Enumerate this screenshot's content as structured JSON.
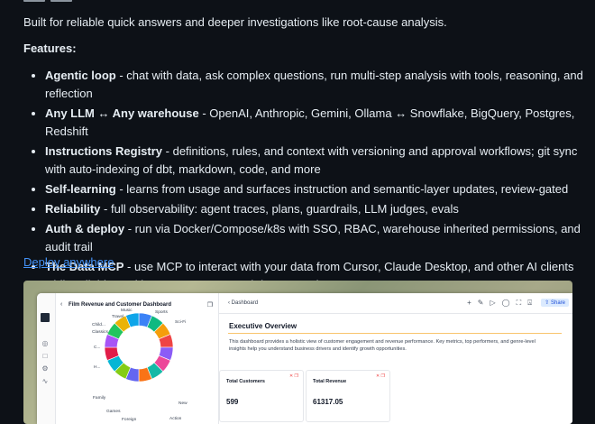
{
  "intro": "Built for reliable quick answers and deeper investigations like root-cause analysis.",
  "features_title": "Features:",
  "features": [
    {
      "title": "Agentic loop",
      "desc": " - chat with data, ask complex questions, run multi-step analysis with tools, reasoning, and reflection"
    },
    {
      "title": "Any LLM ↔ Any warehouse",
      "desc": " - OpenAI, Anthropic, Gemini, Ollama ↔ Snowflake, BigQuery, Postgres, Redshift"
    },
    {
      "title": "Instructions Registry",
      "desc": " - definitions, rules, and context with versioning and approval workflows; git sync with auto-indexing of dbt, markdown, code, and more"
    },
    {
      "title": "Self-learning",
      "desc": " - learns from usage and surfaces instruction and semantic-layer updates, review-gated"
    },
    {
      "title": "Reliability",
      "desc": " - full observability: agent traces, plans, guardrails, LLM judges, evals"
    },
    {
      "title": "Auth & deploy",
      "desc": " - run via Docker/Compose/k8s with SSO, RBAC, warehouse inherited permissions, and audit trail"
    },
    {
      "title": "The Data MCP",
      "desc": " - use MCP to interact with your data from Cursor, Claude Desktop, and other AI clients while reliably tracking your requests and data operations"
    }
  ],
  "deploy_link": "Deploy anywhere",
  "screenshot": {
    "left_title": "Film Revenue and Customer Dashboard",
    "tab": "Dashboard",
    "share": "Share",
    "exec_title": "Executive Overview",
    "exec_desc": "This dashboard provides a holistic view of customer engagement and revenue performance. Key metrics, top performers, and genre-level insights help you understand business drivers and identify growth opportunities.",
    "cards": [
      {
        "title": "Total Customers",
        "value": "599"
      },
      {
        "title": "Total Revenue",
        "value": "61317.05"
      }
    ],
    "donut_labels": [
      "Music",
      "Sports",
      "Travel",
      "Sci-Fi",
      "Child...",
      "Classics",
      "C...",
      "H...",
      "Family",
      "Games",
      "Foreign",
      "New",
      "Action"
    ],
    "donut_colors": [
      "#3b82f6",
      "#10b981",
      "#f59e0b",
      "#ef4444",
      "#8b5cf6",
      "#ec4899",
      "#14b8a6",
      "#f97316",
      "#6366f1",
      "#84cc16",
      "#06b6d4",
      "#e11d48",
      "#a855f7",
      "#22c55e",
      "#eab308",
      "#0ea5e9"
    ]
  }
}
